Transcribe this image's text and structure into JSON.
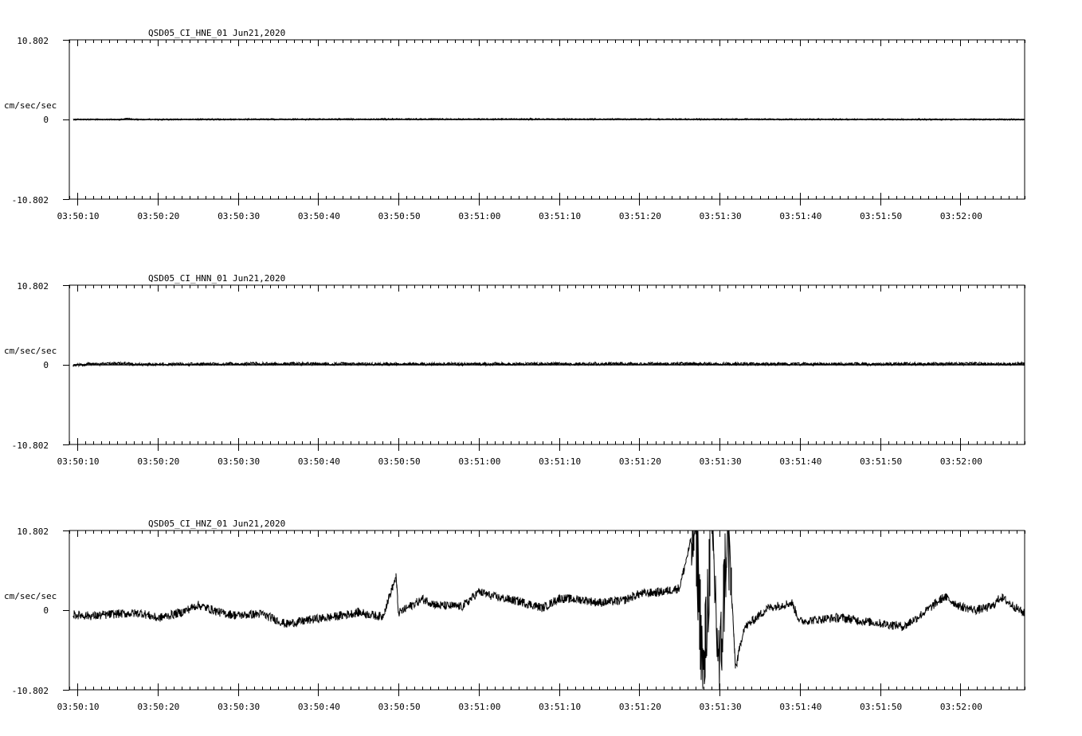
{
  "chart_data": [
    {
      "type": "line",
      "title": "QSD05_CI_HNE_01  Jun21,2020",
      "ylabel": "cm/sec/sec",
      "ylim": [
        -10.802,
        10.802
      ],
      "y_ticks": [
        "10.802",
        "0",
        "-10.802"
      ],
      "x_ticks": [
        "03:50:10",
        "03:50:20",
        "03:50:30",
        "03:50:40",
        "03:50:50",
        "03:51:00",
        "03:51:10",
        "03:51:20",
        "03:51:30",
        "03:51:40",
        "03:51:50",
        "03:52:00"
      ],
      "x_range_seconds": [
        9,
        128
      ],
      "trace_start_seconds": 9.5,
      "series": [
        {
          "x": [
            9.5,
            15.5,
            16.3,
            17,
            55,
            128
          ],
          "y": [
            0,
            0,
            0.15,
            0,
            0.05,
            0
          ]
        }
      ]
    },
    {
      "type": "line",
      "title": "QSD05_CI_HNN_01  Jun21,2020",
      "ylabel": "cm/sec/sec",
      "ylim": [
        -10.802,
        10.802
      ],
      "y_ticks": [
        "10.802",
        "0",
        "-10.802"
      ],
      "x_ticks": [
        "03:50:10",
        "03:50:20",
        "03:50:30",
        "03:50:40",
        "03:50:50",
        "03:51:00",
        "03:51:10",
        "03:51:20",
        "03:51:30",
        "03:51:40",
        "03:51:50",
        "03:52:00"
      ],
      "x_range_seconds": [
        9,
        128
      ],
      "trace_start_seconds": 9.5,
      "series": [
        {
          "x": [
            9.5,
            16,
            17,
            35,
            60,
            80,
            100,
            128
          ],
          "y": [
            0,
            0.2,
            0.05,
            0.15,
            0.1,
            0.15,
            0.1,
            0.15
          ]
        }
      ]
    },
    {
      "type": "line",
      "title": "QSD05_CI_HNZ_01  Jun21,2020",
      "ylabel": "cm/sec/sec",
      "ylim": [
        -10.802,
        10.802
      ],
      "y_ticks": [
        "10.802",
        "0",
        "-10.802"
      ],
      "x_ticks": [
        "03:50:10",
        "03:50:20",
        "03:50:30",
        "03:50:40",
        "03:50:50",
        "03:51:00",
        "03:51:10",
        "03:51:20",
        "03:51:30",
        "03:51:40",
        "03:51:50",
        "03:52:00"
      ],
      "x_range_seconds": [
        9,
        128
      ],
      "trace_start_seconds": 9.5,
      "series": [
        {
          "x": [
            9.5,
            12,
            15,
            18,
            20,
            23,
            25,
            28,
            30,
            33,
            36,
            39,
            42,
            45,
            48,
            49.7,
            50,
            53,
            55,
            58,
            60,
            62,
            65,
            68,
            70,
            73,
            75,
            78,
            80,
            83,
            85,
            87,
            88,
            89,
            90,
            91,
            92,
            93,
            96,
            99,
            100,
            103,
            105,
            108,
            110,
            113,
            115,
            118,
            120,
            122,
            124,
            125,
            128
          ],
          "y": [
            -0.6,
            -0.8,
            -0.5,
            -0.4,
            -1.1,
            -0.3,
            0.7,
            -0.4,
            -0.7,
            -0.5,
            -1.9,
            -1.3,
            -0.9,
            -0.3,
            -0.9,
            4.5,
            -0.4,
            1.5,
            0.6,
            0.5,
            2.5,
            1.8,
            1.2,
            0.3,
            1.6,
            1.4,
            1.0,
            1.3,
            2.2,
            2.5,
            3.0,
            12.0,
            -10.0,
            12.0,
            -9.5,
            12.0,
            -8.0,
            -2.5,
            0.3,
            1.0,
            -1.5,
            -1.2,
            -1.0,
            -1.5,
            -1.8,
            -2.2,
            -0.7,
            1.8,
            0.5,
            0.0,
            0.5,
            1.8,
            -0.5
          ]
        }
      ]
    }
  ]
}
